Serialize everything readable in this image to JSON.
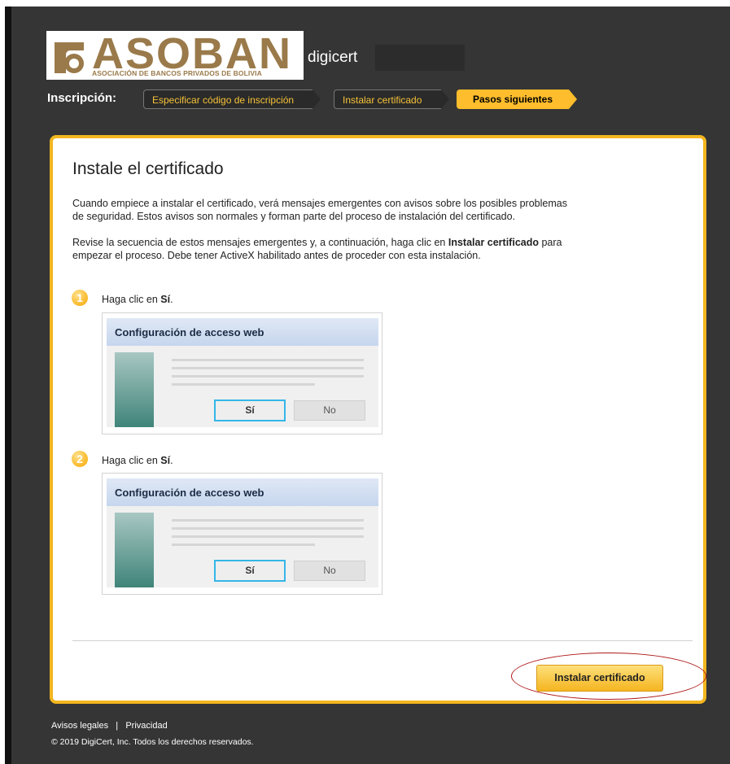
{
  "header": {
    "logo_text": "ASOBAN",
    "logo_subtitle": "ASOCIACIÓN DE BANCOS PRIVADOS DE BOLIVIA",
    "partner_text": "digicert"
  },
  "progress": {
    "label": "Inscripción:",
    "steps": [
      {
        "label": "Especificar código de inscripción",
        "state": "done"
      },
      {
        "label": "Instalar certificado",
        "state": "done"
      },
      {
        "label": "Pasos siguientes",
        "state": "active"
      }
    ]
  },
  "main": {
    "title": "Instale el certificado",
    "para1_line1": "Cuando empiece a instalar el certificado, verá mensajes emergentes con avisos sobre los posibles problemas",
    "para1_line2": "de seguridad. Estos avisos son normales y forman parte del proceso de instalación del certificado.",
    "para2_line1_a": "Revise la secuencia de estos mensajes emergentes y, a continuación, haga clic en ",
    "para2_line1_bold": "Instalar certificado",
    "para2_line1_b": " para",
    "para2_line2": "empezar el proceso. Debe tener ActiveX habilitado antes de proceder con esta instalación.",
    "steps": [
      {
        "number": "1",
        "text_prefix": "Haga clic en ",
        "text_bold": "Sí",
        "text_suffix": ".",
        "dialog_title": "Configuración de acceso web",
        "yes_label": "Sí",
        "no_label": "No"
      },
      {
        "number": "2",
        "text_prefix": "Haga clic en ",
        "text_bold": "Sí",
        "text_suffix": ".",
        "dialog_title": "Configuración de acceso web",
        "yes_label": "Sí",
        "no_label": "No"
      }
    ],
    "install_button": "Instalar certificado"
  },
  "footer": {
    "legal_link": "Avisos legales",
    "separator": "|",
    "privacy_link": "Privacidad",
    "copyright": "© 2019 DigiCert, Inc. Todos los derechos reservados."
  },
  "colors": {
    "accent": "#f3b61f",
    "background": "#353535",
    "highlight_ellipse": "#b01818"
  }
}
